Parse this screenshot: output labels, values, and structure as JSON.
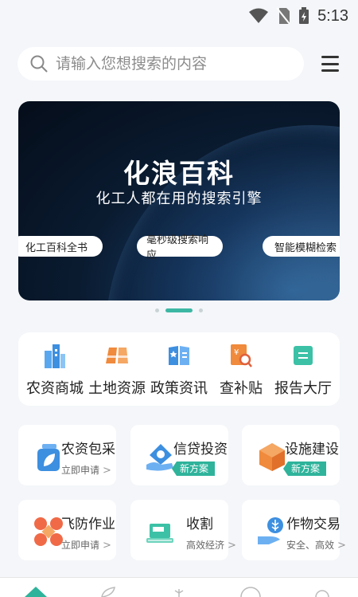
{
  "status": {
    "time": "5:13"
  },
  "search": {
    "placeholder": "请输入您想搜索的内容"
  },
  "banner": {
    "title": "化浪百科",
    "subtitle": "化工人都在用的搜索引擎",
    "chips": [
      "化工百科全书",
      "毫秒级搜索响应",
      "智能模糊检索"
    ]
  },
  "quick_links": [
    {
      "label": "农资商城",
      "icon": "building-icon"
    },
    {
      "label": "土地资源",
      "icon": "land-icon"
    },
    {
      "label": "政策资讯",
      "icon": "book-icon"
    },
    {
      "label": "查补贴",
      "icon": "subsidy-search-icon"
    },
    {
      "label": "报告大厅",
      "icon": "report-icon"
    }
  ],
  "services": [
    {
      "title": "农资包采",
      "sub": "立即申请"
    },
    {
      "title": "信贷投资",
      "badge": "新方案"
    },
    {
      "title": "设施建设",
      "badge": "新方案"
    },
    {
      "title": "飞防作业",
      "sub": "立即申请"
    },
    {
      "title": "收割",
      "sub": "高效经济"
    },
    {
      "title": "作物交易",
      "sub": "安全、高效"
    }
  ],
  "colors": {
    "accent": "#2fb39b",
    "icon_blue": "#3d8fe0",
    "icon_orange": "#f08a3c"
  }
}
